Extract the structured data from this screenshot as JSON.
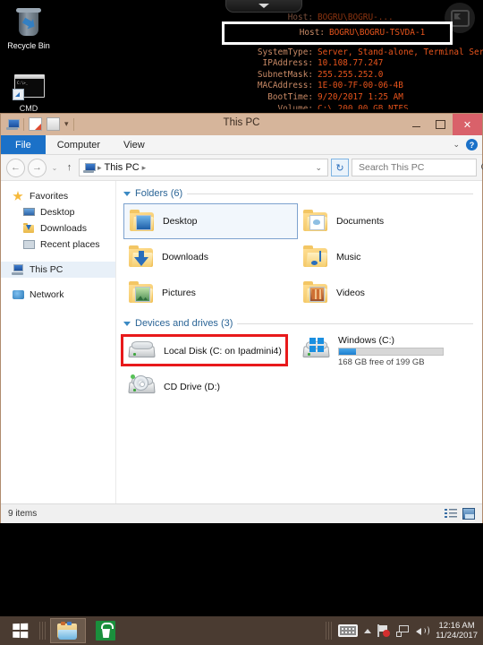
{
  "desktop": {
    "background_color": "#000000",
    "icons": [
      {
        "label": "Recycle Bin",
        "icon": "recycle-bin-icon"
      },
      {
        "label": "CMD",
        "icon": "command-prompt-icon"
      }
    ]
  },
  "rdp_bar": {
    "chevron_icon": "chevron-down-icon"
  },
  "bginfo": {
    "obscured_top_row": {
      "label": "Host:",
      "value": "BOGRU\\BOGRU-..."
    },
    "highlighted_row": {
      "label": "Host:",
      "value": "BOGRU\\BOGRU-TSVDA-1"
    },
    "rows": [
      {
        "label": "SystemType:",
        "value": "Server, Stand-alone, Terminal Server"
      },
      {
        "label": "IPAddress:",
        "value": "10.108.77.247"
      },
      {
        "label": "SubnetMask:",
        "value": "255.255.252.0"
      },
      {
        "label": "MACAddress:",
        "value": "1E-00-7F-00-06-4B"
      },
      {
        "label": "BootTime:",
        "value": "9/20/2017 1:25 AM"
      },
      {
        "label": "Volume:",
        "value": "C:\\ 200.00 GB NTFS"
      }
    ],
    "label_color": "#c98a66",
    "value_color": "#e8541c",
    "highlight_color": "#ffffff"
  },
  "window": {
    "title": "This PC",
    "controls": {
      "minimize_label": "–",
      "maximize_label": "□",
      "close_label": "✕"
    },
    "quick_access": {
      "pc_icon": "this-pc-icon",
      "properties_icon": "properties-icon",
      "new_folder_icon": "new-folder-icon",
      "customize_caret": "▾"
    },
    "ribbon_tabs": [
      {
        "label": "File",
        "active": true
      },
      {
        "label": "Computer",
        "active": false
      },
      {
        "label": "View",
        "active": false
      }
    ],
    "ribbon_right": {
      "collapse_caret": "⌄",
      "help_label": "?"
    },
    "address_bar": {
      "back_icon": "←",
      "forward_icon": "→",
      "history_icon": "⌄",
      "up_icon": "↑",
      "breadcrumb_icon": "this-pc-icon",
      "breadcrumb": [
        "This PC"
      ],
      "separator": "▸",
      "dropdown_caret": "⌄",
      "refresh_icon": "↻"
    },
    "search": {
      "placeholder": "Search This PC",
      "value": "",
      "icon": "search-icon"
    },
    "nav_pane": [
      {
        "label": "Favorites",
        "icon": "star-icon",
        "level": 0,
        "selected": false
      },
      {
        "label": "Desktop",
        "icon": "desktop-icon",
        "level": 1,
        "selected": false
      },
      {
        "label": "Downloads",
        "icon": "downloads-icon",
        "level": 1,
        "selected": false
      },
      {
        "label": "Recent places",
        "icon": "recent-places-icon",
        "level": 1,
        "selected": false
      },
      {
        "label": "This PC",
        "icon": "this-pc-icon",
        "level": 0,
        "selected": true
      },
      {
        "label": "Network",
        "icon": "network-icon",
        "level": 0,
        "selected": false
      }
    ],
    "groups": {
      "folders": {
        "title": "Folders (6)",
        "items": [
          {
            "label": "Desktop",
            "icon": "folder-desktop-icon",
            "selected": true
          },
          {
            "label": "Documents",
            "icon": "folder-documents-icon",
            "selected": false
          },
          {
            "label": "Downloads",
            "icon": "folder-downloads-icon",
            "selected": false
          },
          {
            "label": "Music",
            "icon": "folder-music-icon",
            "selected": false
          },
          {
            "label": "Pictures",
            "icon": "folder-pictures-icon",
            "selected": false
          },
          {
            "label": "Videos",
            "icon": "folder-videos-icon",
            "selected": false
          }
        ]
      },
      "devices": {
        "title": "Devices and drives (3)",
        "items": [
          {
            "label": "Local Disk (C: on Ipadmini4)",
            "icon": "local-disk-icon",
            "highlighted": true,
            "capacity_text": "",
            "fill_percent": 0
          },
          {
            "label": "Windows (C:)",
            "icon": "windows-drive-icon",
            "highlighted": false,
            "capacity_text": "168 GB free of 199 GB",
            "fill_percent": 16
          },
          {
            "label": "CD Drive (D:)",
            "icon": "cd-drive-icon",
            "highlighted": false,
            "capacity_text": "",
            "fill_percent": 0
          }
        ]
      }
    },
    "status_bar": {
      "item_count": "9 items",
      "details_view_icon": "details-view-icon",
      "large_icons_view_icon": "large-icons-view-icon"
    },
    "highlight_color": "#e8191b"
  },
  "taskbar": {
    "start_label": "Start",
    "start_icon": "windows-start-icon",
    "tasks": [
      {
        "label": "File Explorer",
        "icon": "file-explorer-icon",
        "active": true
      },
      {
        "label": "Store",
        "icon": "windows-store-icon",
        "active": false
      }
    ],
    "tray": {
      "keyboard_icon": "keyboard-icon",
      "overflow_icon": "chevron-up-icon",
      "action_center_icon": "flag-icon",
      "action_center_badge": "",
      "network_icon": "network-icon",
      "volume_icon": "volume-icon",
      "time": "12:16 AM",
      "date": "11/24/2017"
    }
  }
}
